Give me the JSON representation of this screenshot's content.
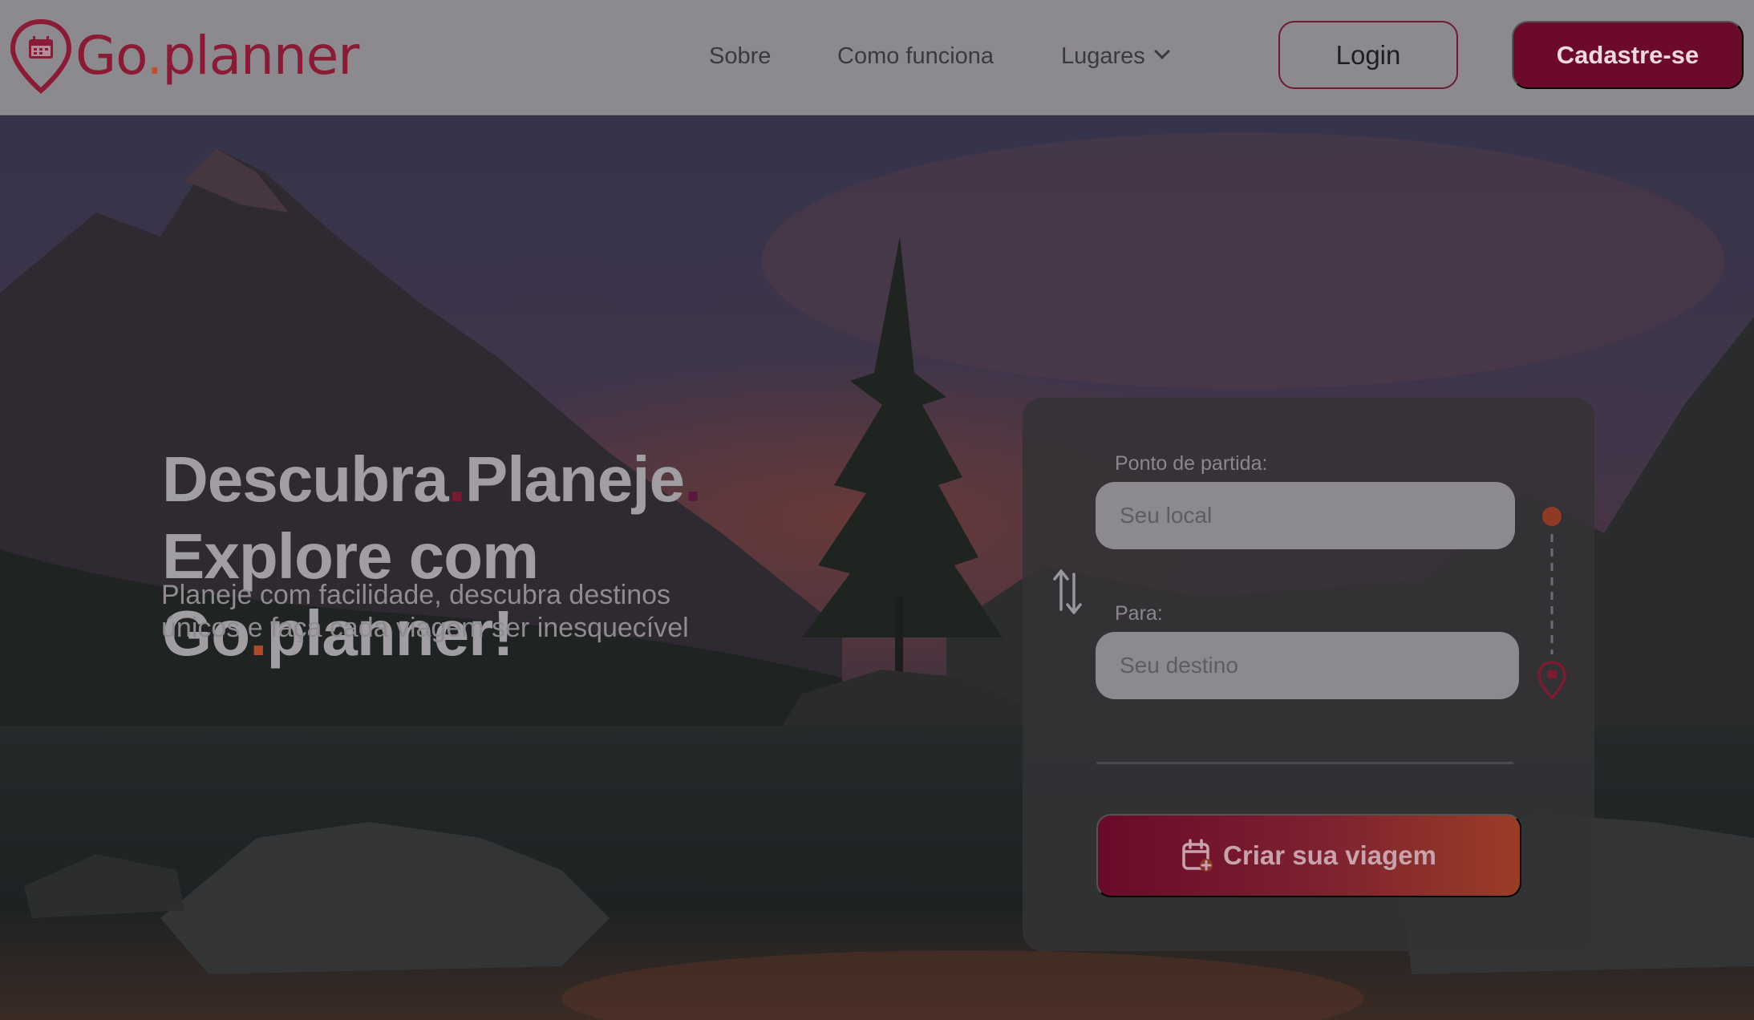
{
  "brand": {
    "name_part1": "Go",
    "name_dot": ".",
    "name_part2": "planner",
    "logo_icon": "map-pin-calendar-icon",
    "color": "#8a1b35",
    "accent": "#c24e2a"
  },
  "nav": {
    "items": [
      {
        "label": "Sobre"
      },
      {
        "label": "Como funciona"
      },
      {
        "label": "Lugares",
        "icon": "chevron-down-icon"
      }
    ],
    "login_label": "Login",
    "signup_label": "Cadastre-se"
  },
  "hero": {
    "line1_a": "Descubra",
    "line1_b": "Planeje",
    "line2": "Explore com",
    "line3_a": "Go",
    "line3_b": "planner!",
    "dot": ".",
    "subtext": "Planeje com facilidade, descubra destinos únicos e faça cada viagem ser inesquecível"
  },
  "form": {
    "origin_label": "Ponto de partida:",
    "origin_placeholder": "Seu local",
    "origin_value": "",
    "destination_label": "Para:",
    "destination_placeholder": "Seu destino",
    "destination_value": "",
    "swap_icon": "swap-vertical-icon",
    "route_icons": [
      "origin-dot-icon",
      "destination-pin-icon"
    ],
    "submit_label": "Criar sua viagem",
    "submit_icon": "calendar-plus-icon"
  },
  "colors": {
    "primary": "#6b0a2a",
    "gradient_end": "#9a3d26",
    "overlay": "#2b2a33"
  }
}
